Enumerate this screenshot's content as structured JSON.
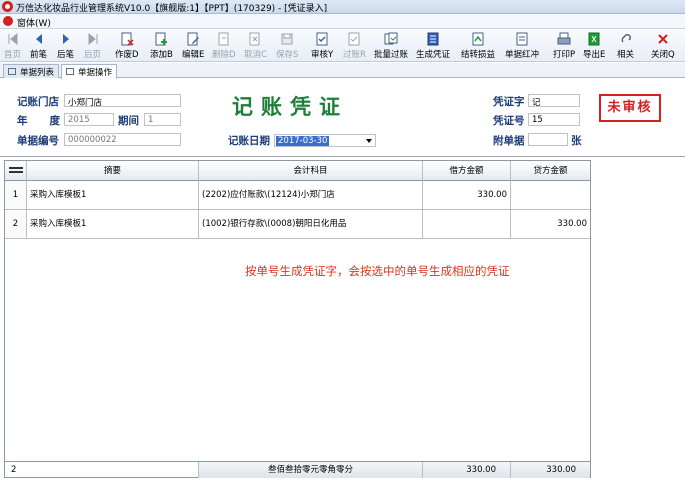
{
  "window": {
    "title": "万信达化妆品行业管理系统V10.0【旗舰版:1】【PPT】(170329) - [凭证录入]"
  },
  "menu": {
    "window_label": "窗体(W)"
  },
  "toolbar": {
    "buttons": [
      {
        "label": "首页",
        "icon": "first-page-icon",
        "enabled": false
      },
      {
        "label": "前笔",
        "icon": "prev-icon",
        "enabled": true
      },
      {
        "label": "后笔",
        "icon": "next-icon",
        "enabled": true
      },
      {
        "label": "后页",
        "icon": "last-page-icon",
        "enabled": false
      },
      {
        "label": "作废D",
        "icon": "void-icon",
        "enabled": true
      },
      {
        "label": "添加B",
        "icon": "add-icon",
        "enabled": true
      },
      {
        "label": "编辑E",
        "icon": "edit-icon",
        "enabled": true
      },
      {
        "label": "删除D",
        "icon": "delete-icon",
        "enabled": false
      },
      {
        "label": "取消C",
        "icon": "cancel-icon",
        "enabled": false
      },
      {
        "label": "保存S",
        "icon": "save-icon",
        "enabled": false
      },
      {
        "label": "审核Y",
        "icon": "audit-icon",
        "enabled": true
      },
      {
        "label": "过账R",
        "icon": "post-icon",
        "enabled": false
      },
      {
        "label": "批量过账",
        "icon": "batch-post-icon",
        "enabled": true
      },
      {
        "label": "生成凭证",
        "icon": "generate-voucher-icon",
        "enabled": true
      },
      {
        "label": "结转损益",
        "icon": "carry-forward-icon",
        "enabled": true
      },
      {
        "label": "单据红冲",
        "icon": "red-reverse-icon",
        "enabled": true
      },
      {
        "label": "打印P",
        "icon": "print-icon",
        "enabled": true
      },
      {
        "label": "导出E",
        "icon": "export-icon",
        "enabled": true
      },
      {
        "label": "相关",
        "icon": "related-icon",
        "enabled": true
      },
      {
        "label": "关闭Q",
        "icon": "close-icon",
        "enabled": true
      }
    ]
  },
  "tabs": [
    {
      "label": "单据列表",
      "active": false
    },
    {
      "label": "单据操作",
      "active": true
    }
  ],
  "header": {
    "title": "记账凭证",
    "store_label": "记账门店",
    "store_value": "小郑门店",
    "year_label": "年    度",
    "year_value": "2015",
    "period_label": "期间",
    "period_value": "1",
    "docno_label": "单据编号",
    "docno_value": "000000022",
    "date_label": "记账日期",
    "date_value": "2017-03-30",
    "voucher_word_label": "凭证字",
    "voucher_word_value": "记",
    "voucher_no_label": "凭证号",
    "voucher_no_value": "15",
    "attach_label": "附单据",
    "attach_value": "",
    "attach_unit": "张",
    "status": "未审核"
  },
  "grid": {
    "headers": [
      "摘要",
      "会计科目",
      "借方金额",
      "贷方金额"
    ],
    "rows": [
      {
        "no": "1",
        "summary": "采购入库模板1",
        "account": "(2202)应付账款\\(12124)小郑门店",
        "debit": "330.00",
        "credit": ""
      },
      {
        "no": "2",
        "summary": "采购入库模板1",
        "account": "(1002)银行存款\\(0008)朝阳日化用品",
        "debit": "",
        "credit": "330.00"
      }
    ],
    "footer": {
      "count": "2",
      "amount_words": "叁佰叁拾零元零角零分",
      "debit_total": "330.00",
      "credit_total": "330.00"
    }
  },
  "note": "按单号生成凭证字，会按选中的单号生成相应的凭证",
  "colors": {
    "title_green": "#1f7f3a",
    "label_blue": "#1c3c78",
    "stamp_red": "#d42020",
    "note_red": "#e0321e"
  }
}
